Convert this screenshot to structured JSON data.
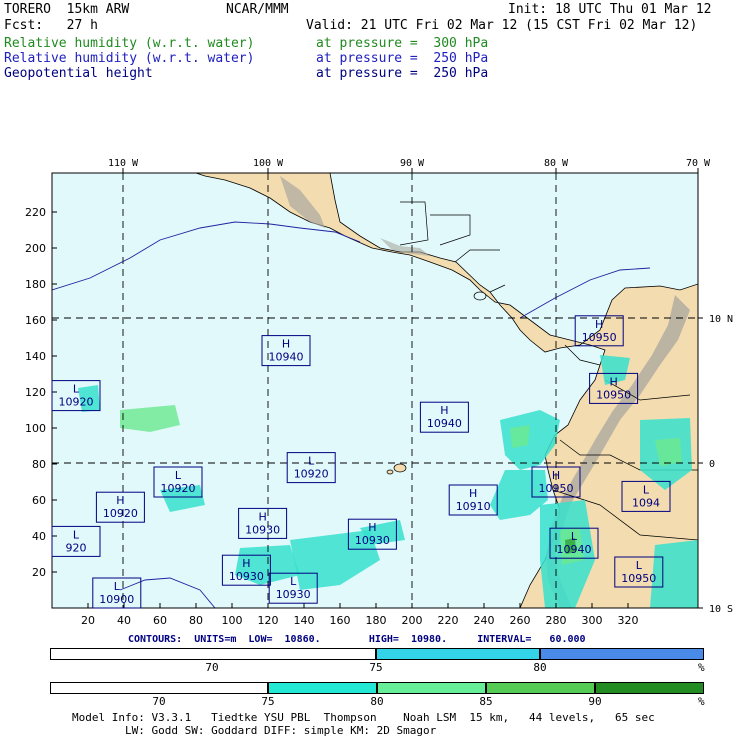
{
  "header": {
    "model": "TORERO  15km ARW",
    "center": "NCAR/MMM",
    "init": "Init: 18 UTC Thu 01 Mar 12",
    "fcst": "Fcst:   27 h",
    "valid": "Valid: 21 UTC Fri 02 Mar 12 (15 CST Fri 02 Mar 12)",
    "fields": [
      {
        "name": "Relative humidity (w.r.t. water)",
        "level": "at pressure =  300 hPa",
        "color": "#1f8a1f"
      },
      {
        "name": "Relative humidity (w.r.t. water)",
        "level": "at pressure =  250 hPa",
        "color": "#2020c0"
      },
      {
        "name": "Geopotential height",
        "level": "at pressure =  250 hPa",
        "color": "#000080"
      }
    ]
  },
  "map": {
    "lon_labels": [
      "110 W",
      "100 W",
      "90 W",
      "80 W",
      "70 W"
    ],
    "lat_labels": [
      "10 N",
      "0",
      "10 S"
    ],
    "y_ticks": [
      "220",
      "200",
      "180",
      "160",
      "140",
      "120",
      "100",
      "80",
      "60",
      "40",
      "20"
    ],
    "x_ticks": [
      "20",
      "40",
      "60",
      "80",
      "100",
      "120",
      "140",
      "160",
      "180",
      "200",
      "220",
      "240",
      "260",
      "280",
      "300",
      "320"
    ],
    "colors": {
      "ocean": "#e2f9fb",
      "land": "#f3dcb0",
      "mountain": "#aaa79f",
      "rh_light": "#36e0cc",
      "rh_mid": "#6ce88e",
      "rh_dark": "#2ea33a"
    },
    "systems": [
      {
        "type": "H",
        "value": "10950",
        "grid_x": 304,
        "grid_y": 154
      },
      {
        "type": "H",
        "value": "10940",
        "grid_x": 130,
        "grid_y": 143
      },
      {
        "type": "L",
        "value": "10920",
        "grid_x": 12,
        "grid_y": 118
      },
      {
        "type": "H",
        "value": "10950",
        "grid_x": 312,
        "grid_y": 122
      },
      {
        "type": "H",
        "value": "10940",
        "grid_x": 218,
        "grid_y": 106
      },
      {
        "type": "L",
        "value": "10920",
        "grid_x": 144,
        "grid_y": 78
      },
      {
        "type": "L",
        "value": "10920",
        "grid_x": 70,
        "grid_y": 70
      },
      {
        "type": "H",
        "value": "10950",
        "grid_x": 280,
        "grid_y": 70
      },
      {
        "type": "H",
        "value": "10920",
        "grid_x": 38,
        "grid_y": 56
      },
      {
        "type": "H",
        "value": "10910",
        "grid_x": 234,
        "grid_y": 60
      },
      {
        "type": "L",
        "value": "1094",
        "grid_x": 330,
        "grid_y": 62
      },
      {
        "type": "H",
        "value": "10930",
        "grid_x": 117,
        "grid_y": 47
      },
      {
        "type": "H",
        "value": "10930",
        "grid_x": 178,
        "grid_y": 41
      },
      {
        "type": "L",
        "value": "10940",
        "grid_x": 290,
        "grid_y": 36
      },
      {
        "type": "L",
        "value": "920",
        "grid_x": 3,
        "grid_y": 37
      },
      {
        "type": "H",
        "value": "10930",
        "grid_x": 108,
        "grid_y": 21
      },
      {
        "type": "L",
        "value": "10930",
        "grid_x": 134,
        "grid_y": 11
      },
      {
        "type": "L",
        "value": "10950",
        "grid_x": 326,
        "grid_y": 20
      },
      {
        "type": "L",
        "value": "10900",
        "grid_x": 36,
        "grid_y": 4
      }
    ]
  },
  "contours": {
    "text": "CONTOURS:  UNITS=m  LOW=  10860.        HIGH=  10980.     INTERVAL=   60.000"
  },
  "colorbar_250": {
    "ticks": [
      "70",
      "75",
      "80"
    ],
    "percent": "%",
    "colors": [
      "#ffffff",
      "#33d3e8",
      "#4a8ae8"
    ]
  },
  "colorbar_300": {
    "ticks": [
      "70",
      "75",
      "80",
      "85",
      "90"
    ],
    "percent": "%",
    "colors": [
      "#ffffff",
      "#22e8d4",
      "#66ee99",
      "#55cc55",
      "#228b22"
    ]
  },
  "model_info": {
    "line1": "Model Info: V3.3.1   Tiedtke YSU PBL  Thompson    Noah LSM  15 km,   44 levels,   65 sec",
    "line2": "        LW: Godd SW: Goddard DIFF: simple KM: 2D Smagor"
  }
}
